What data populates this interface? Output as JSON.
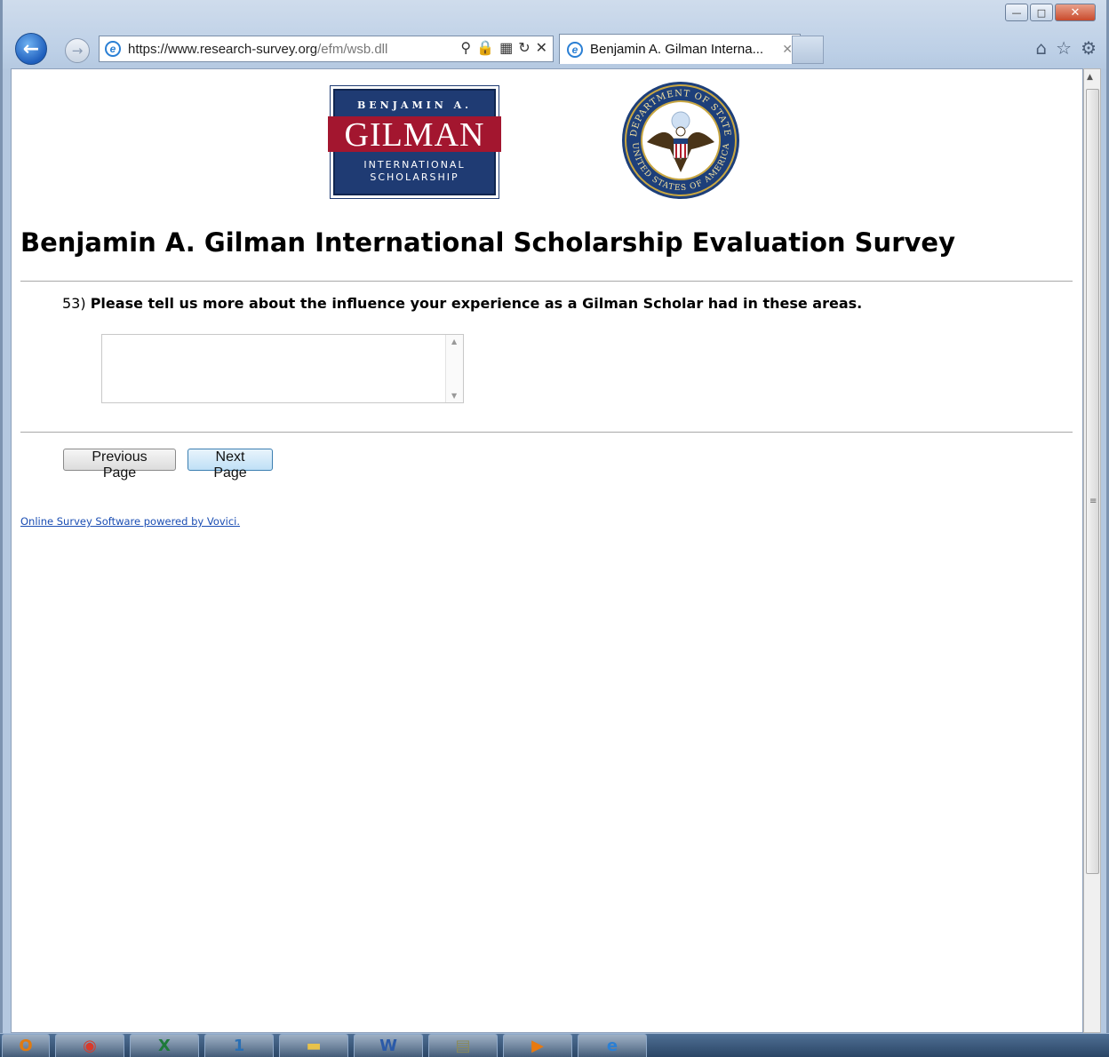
{
  "browser": {
    "url_host": "https://www.research-survey.org",
    "url_path": "/efm/wsb.dll",
    "tab_title": "Benjamin A. Gilman Interna...",
    "window_controls": [
      "minimize",
      "maximize",
      "close"
    ]
  },
  "logos": {
    "gilman": {
      "top": "BENJAMIN A.",
      "middle": "GILMAN",
      "bottom_1": "INTERNATIONAL",
      "bottom_2": "SCHOLARSHIP"
    },
    "seal": {
      "top_text": "DEPARTMENT OF STATE",
      "bottom_text": "UNITED STATES OF AMERICA"
    }
  },
  "page": {
    "title": "Benjamin A. Gilman International Scholarship Evaluation Survey",
    "question_number": "53)",
    "question_text": "Please tell us more about the influence your experience as a Gilman Scholar had in these areas.",
    "answer_value": "",
    "prev_button": "Previous Page",
    "next_button": "Next Page",
    "footer_link": "Online Survey Software powered by Vovici."
  },
  "taskbar": {
    "items": [
      "outlook-icon",
      "chrome-icon",
      "excel-icon",
      "app-icon",
      "folder-icon",
      "word-icon",
      "app2-icon",
      "media-icon",
      "ie-icon"
    ]
  },
  "colors": {
    "gilman_blue": "#1f3b73",
    "gilman_red": "#a3162f",
    "link": "#1a4db3"
  }
}
